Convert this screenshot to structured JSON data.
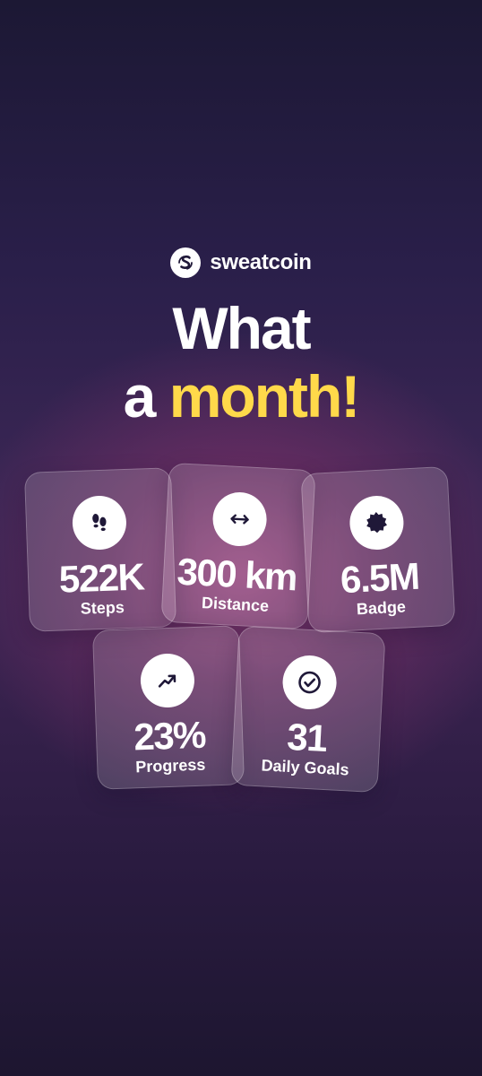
{
  "brand": {
    "name": "sweatcoin",
    "logo_icon": "sweatcoin-logo-icon"
  },
  "headline": {
    "line1": "What",
    "line2_prefix": "a ",
    "line2_accent": "month!",
    "accent_color": "#ffd94a"
  },
  "stats": {
    "steps": {
      "value": "522K",
      "label": "Steps",
      "icon": "footprints-icon"
    },
    "distance": {
      "value": "300 km",
      "label": "Distance",
      "icon": "double-arrow-icon"
    },
    "badge": {
      "value": "6.5M",
      "label": "Badge",
      "icon": "badge-icon"
    },
    "progress": {
      "value": "23%",
      "label": "Progress",
      "icon": "trending-up-icon"
    },
    "daily_goals": {
      "value": "31",
      "label": "Daily Goals",
      "icon": "check-circle-icon"
    }
  },
  "colors": {
    "background_top": "#1c1834",
    "background_glow": "#96427c",
    "icon_fill": "#1f1838"
  }
}
